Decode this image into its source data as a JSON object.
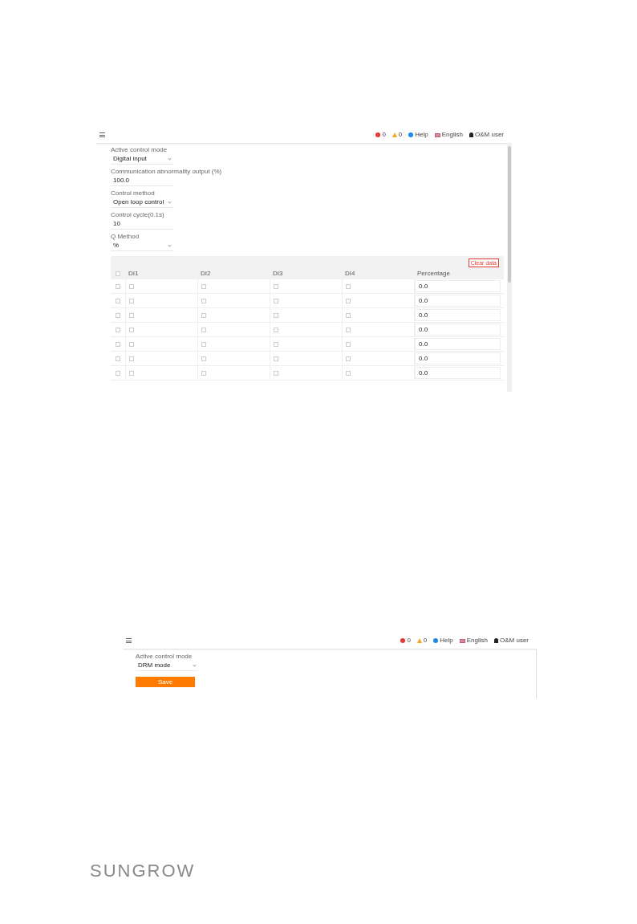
{
  "screenshot_1": {
    "header": {
      "errors": "0",
      "warnings": "0",
      "help": "Help",
      "language": "English",
      "user": "O&M user"
    },
    "fields": [
      {
        "kind": "select",
        "label": "Active control mode",
        "value": "Digital input"
      },
      {
        "kind": "input",
        "label": "Communication abnormality output (%)",
        "value": "100.0"
      },
      {
        "kind": "select",
        "label": "Control method",
        "value": "Open loop control"
      },
      {
        "kind": "input",
        "label": "Control cycle(0.1s)",
        "value": "10"
      },
      {
        "kind": "select",
        "label": "Q Method",
        "value": "%"
      }
    ],
    "table": {
      "clear_button": "Clear data",
      "select_all": {
        "checked": false
      },
      "columns": [
        "DI1",
        "DI2",
        "DI3",
        "DI4",
        "Percentage"
      ],
      "rows": [
        {
          "selected": false,
          "di": [
            false,
            false,
            false,
            false
          ],
          "percentage": "0.0"
        },
        {
          "selected": false,
          "di": [
            false,
            false,
            false,
            false
          ],
          "percentage": "0.0"
        },
        {
          "selected": false,
          "di": [
            false,
            false,
            false,
            false
          ],
          "percentage": "0.0"
        },
        {
          "selected": false,
          "di": [
            false,
            false,
            false,
            false
          ],
          "percentage": "0.0"
        },
        {
          "selected": false,
          "di": [
            false,
            false,
            false,
            false
          ],
          "percentage": "0.0"
        },
        {
          "selected": false,
          "di": [
            false,
            false,
            false,
            false
          ],
          "percentage": "0.0"
        },
        {
          "selected": false,
          "di": [
            false,
            false,
            false,
            false
          ],
          "percentage": "0.0"
        }
      ]
    }
  },
  "screenshot_2": {
    "header": {
      "errors": "0",
      "warnings": "0",
      "help": "Help",
      "language": "English",
      "user": "O&M user"
    },
    "fields": [
      {
        "kind": "select",
        "label": "Active control mode",
        "value": "DRM mode"
      }
    ],
    "save_button": "Save"
  },
  "footer": {
    "logo": "SUNGROW"
  }
}
